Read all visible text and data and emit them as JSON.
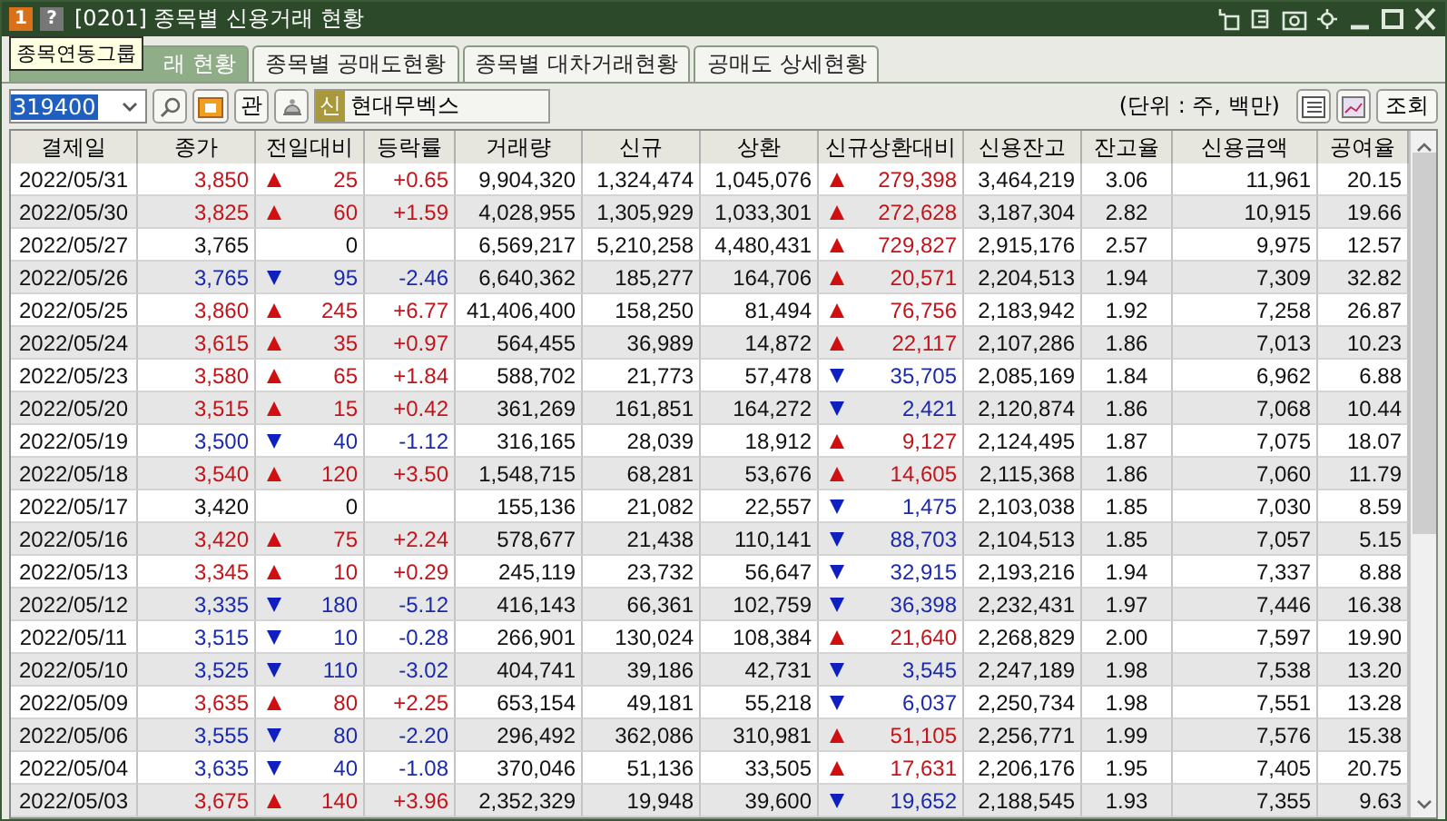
{
  "window": {
    "badge": "1",
    "help": "?",
    "title": "[0201] 종목별 신용거래 현황"
  },
  "tooltip": "종목연동그룹",
  "tabs": [
    {
      "label": "래 현황",
      "selected": true
    },
    {
      "label": "종목별 공매도현황",
      "selected": false
    },
    {
      "label": "종목별 대차거래현황",
      "selected": false
    },
    {
      "label": "공매도 상세현황",
      "selected": false
    }
  ],
  "toolbar": {
    "code": "319400",
    "relation_button": "관",
    "credit_tag": "신",
    "stock_name": "현대무벡스",
    "unit": "(단위 : 주, 백만)",
    "query_button": "조회"
  },
  "table": {
    "columns": [
      "결제일",
      "종가",
      "전일대비",
      "등락률",
      "거래량",
      "신규",
      "상환",
      "신규상환대비",
      "신용잔고",
      "잔고율",
      "신용금액",
      "공여율"
    ],
    "rows": [
      {
        "date": "2022/05/31",
        "close": "3,850",
        "rise": true,
        "fall": false,
        "change": "25",
        "rate": "+0.65",
        "volume": "9,904,320",
        "new": "1,324,474",
        "repay": "1,045,076",
        "net_rise": true,
        "net": "279,398",
        "balance": "3,464,219",
        "balance_rate": "3.06",
        "amount": "11,961",
        "supply_rate": "20.15"
      },
      {
        "date": "2022/05/30",
        "close": "3,825",
        "rise": true,
        "fall": false,
        "change": "60",
        "rate": "+1.59",
        "volume": "4,028,955",
        "new": "1,305,929",
        "repay": "1,033,301",
        "net_rise": true,
        "net": "272,628",
        "balance": "3,187,304",
        "balance_rate": "2.82",
        "amount": "10,915",
        "supply_rate": "19.66"
      },
      {
        "date": "2022/05/27",
        "close": "3,765",
        "rise": false,
        "fall": false,
        "change": "0",
        "volume": "6,569,217",
        "new": "5,210,258",
        "repay": "4,480,431",
        "net_rise": true,
        "net": "729,827",
        "balance": "2,915,176",
        "balance_rate": "2.57",
        "amount": "9,975",
        "supply_rate": "12.57"
      },
      {
        "date": "2022/05/26",
        "close": "3,765",
        "rise": false,
        "fall": true,
        "change": "95",
        "rate": "-2.46",
        "volume": "6,640,362",
        "new": "185,277",
        "repay": "164,706",
        "net_rise": true,
        "net": "20,571",
        "balance": "2,204,513",
        "balance_rate": "1.94",
        "amount": "7,309",
        "supply_rate": "32.82"
      },
      {
        "date": "2022/05/25",
        "close": "3,860",
        "rise": true,
        "fall": false,
        "change": "245",
        "rate": "+6.77",
        "volume": "41,406,400",
        "new": "158,250",
        "repay": "81,494",
        "net_rise": true,
        "net": "76,756",
        "balance": "2,183,942",
        "balance_rate": "1.92",
        "amount": "7,258",
        "supply_rate": "26.87"
      },
      {
        "date": "2022/05/24",
        "close": "3,615",
        "rise": true,
        "fall": false,
        "change": "35",
        "rate": "+0.97",
        "volume": "564,455",
        "new": "36,989",
        "repay": "14,872",
        "net_rise": true,
        "net": "22,117",
        "balance": "2,107,286",
        "balance_rate": "1.86",
        "amount": "7,013",
        "supply_rate": "10.23"
      },
      {
        "date": "2022/05/23",
        "close": "3,580",
        "rise": true,
        "fall": false,
        "change": "65",
        "rate": "+1.84",
        "volume": "588,702",
        "new": "21,773",
        "repay": "57,478",
        "net_rise": false,
        "net": "35,705",
        "balance": "2,085,169",
        "balance_rate": "1.84",
        "amount": "6,962",
        "supply_rate": "6.88"
      },
      {
        "date": "2022/05/20",
        "close": "3,515",
        "rise": true,
        "fall": false,
        "change": "15",
        "rate": "+0.42",
        "volume": "361,269",
        "new": "161,851",
        "repay": "164,272",
        "net_rise": false,
        "net": "2,421",
        "balance": "2,120,874",
        "balance_rate": "1.86",
        "amount": "7,068",
        "supply_rate": "10.44"
      },
      {
        "date": "2022/05/19",
        "close": "3,500",
        "rise": false,
        "fall": true,
        "change": "40",
        "rate": "-1.12",
        "volume": "316,165",
        "new": "28,039",
        "repay": "18,912",
        "net_rise": true,
        "net": "9,127",
        "balance": "2,124,495",
        "balance_rate": "1.87",
        "amount": "7,075",
        "supply_rate": "18.07"
      },
      {
        "date": "2022/05/18",
        "close": "3,540",
        "rise": true,
        "fall": false,
        "change": "120",
        "rate": "+3.50",
        "volume": "1,548,715",
        "new": "68,281",
        "repay": "53,676",
        "net_rise": true,
        "net": "14,605",
        "balance": "2,115,368",
        "balance_rate": "1.86",
        "amount": "7,060",
        "supply_rate": "11.79"
      },
      {
        "date": "2022/05/17",
        "close": "3,420",
        "rise": false,
        "fall": false,
        "change": "0",
        "volume": "155,136",
        "new": "21,082",
        "repay": "22,557",
        "net_rise": false,
        "net": "1,475",
        "balance": "2,103,038",
        "balance_rate": "1.85",
        "amount": "7,030",
        "supply_rate": "8.59"
      },
      {
        "date": "2022/05/16",
        "close": "3,420",
        "rise": true,
        "fall": false,
        "change": "75",
        "rate": "+2.24",
        "volume": "578,677",
        "new": "21,438",
        "repay": "110,141",
        "net_rise": false,
        "net": "88,703",
        "balance": "2,104,513",
        "balance_rate": "1.85",
        "amount": "7,057",
        "supply_rate": "5.15"
      },
      {
        "date": "2022/05/13",
        "close": "3,345",
        "rise": true,
        "fall": false,
        "change": "10",
        "rate": "+0.29",
        "volume": "245,119",
        "new": "23,732",
        "repay": "56,647",
        "net_rise": false,
        "net": "32,915",
        "balance": "2,193,216",
        "balance_rate": "1.94",
        "amount": "7,337",
        "supply_rate": "8.88"
      },
      {
        "date": "2022/05/12",
        "close": "3,335",
        "rise": false,
        "fall": true,
        "change": "180",
        "rate": "-5.12",
        "volume": "416,143",
        "new": "66,361",
        "repay": "102,759",
        "net_rise": false,
        "net": "36,398",
        "balance": "2,232,431",
        "balance_rate": "1.97",
        "amount": "7,446",
        "supply_rate": "16.38"
      },
      {
        "date": "2022/05/11",
        "close": "3,515",
        "rise": false,
        "fall": true,
        "change": "10",
        "rate": "-0.28",
        "volume": "266,901",
        "new": "130,024",
        "repay": "108,384",
        "net_rise": true,
        "net": "21,640",
        "balance": "2,268,829",
        "balance_rate": "2.00",
        "amount": "7,597",
        "supply_rate": "19.90"
      },
      {
        "date": "2022/05/10",
        "close": "3,525",
        "rise": false,
        "fall": true,
        "change": "110",
        "rate": "-3.02",
        "volume": "404,741",
        "new": "39,186",
        "repay": "42,731",
        "net_rise": false,
        "net": "3,545",
        "balance": "2,247,189",
        "balance_rate": "1.98",
        "amount": "7,538",
        "supply_rate": "13.20"
      },
      {
        "date": "2022/05/09",
        "close": "3,635",
        "rise": true,
        "fall": false,
        "change": "80",
        "rate": "+2.25",
        "volume": "653,154",
        "new": "49,181",
        "repay": "55,218",
        "net_rise": false,
        "net": "6,037",
        "balance": "2,250,734",
        "balance_rate": "1.98",
        "amount": "7,551",
        "supply_rate": "13.28"
      },
      {
        "date": "2022/05/06",
        "close": "3,555",
        "rise": false,
        "fall": true,
        "change": "80",
        "rate": "-2.20",
        "volume": "296,492",
        "new": "362,086",
        "repay": "310,981",
        "net_rise": true,
        "net": "51,105",
        "balance": "2,256,771",
        "balance_rate": "1.99",
        "amount": "7,576",
        "supply_rate": "15.38"
      },
      {
        "date": "2022/05/04",
        "close": "3,635",
        "rise": false,
        "fall": true,
        "change": "40",
        "rate": "-1.08",
        "volume": "370,046",
        "new": "51,136",
        "repay": "33,505",
        "net_rise": true,
        "net": "17,631",
        "balance": "2,206,176",
        "balance_rate": "1.95",
        "amount": "7,405",
        "supply_rate": "20.75"
      },
      {
        "date": "2022/05/03",
        "close": "3,675",
        "rise": true,
        "fall": false,
        "change": "140",
        "rate": "+3.96",
        "volume": "2,352,329",
        "new": "19,948",
        "repay": "39,600",
        "net_rise": false,
        "net": "19,652",
        "balance": "2,188,545",
        "balance_rate": "1.93",
        "amount": "7,355",
        "supply_rate": "9.63"
      }
    ]
  }
}
